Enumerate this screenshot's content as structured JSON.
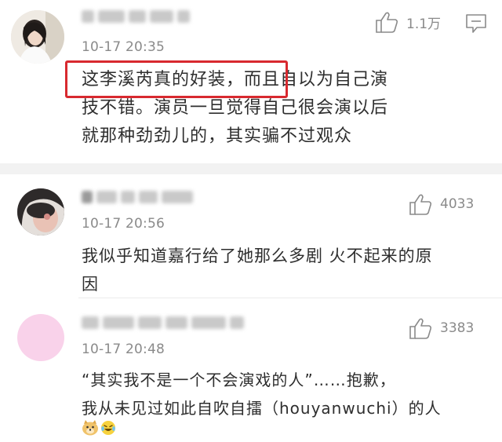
{
  "comments": [
    {
      "timestamp": "10-17 20:35",
      "like_count": "1.1万",
      "text_line1_highlight": "这李溪芮真的好装，",
      "text_line1_rest": "而且自以为自己演",
      "text_line2": "技不错。演员一旦觉得自己很会演以后",
      "text_line3": "就那种劲劲儿的，其实骗不过观众",
      "username_blurred": true,
      "avatar": "woman-photo"
    },
    {
      "timestamp": "10-17 20:56",
      "like_count": "4033",
      "text_line1": "我似乎知道嘉行给了她那么多剧 火不起来的原",
      "text_line2": "因",
      "username_blurred": true,
      "avatar": "girl-photo"
    },
    {
      "timestamp": "10-17 20:48",
      "like_count": "3383",
      "text_line1": "“其实我不是一个不会演戏的人”……抱歉，",
      "text_line2": "我从未见过如此自吹自擂（houyanwuchi）的人",
      "username_blurred": true,
      "avatar": "pink-circle",
      "emojis": [
        "doge-emoji",
        "laugh-cry-emoji"
      ]
    }
  ],
  "icons": {
    "like": "thumbs-up-icon",
    "reply": "comment-icon"
  },
  "colors": {
    "highlight": "#d8292f",
    "meta_text": "#8a8a8a",
    "avatar_pink": "#f9d2ea"
  }
}
